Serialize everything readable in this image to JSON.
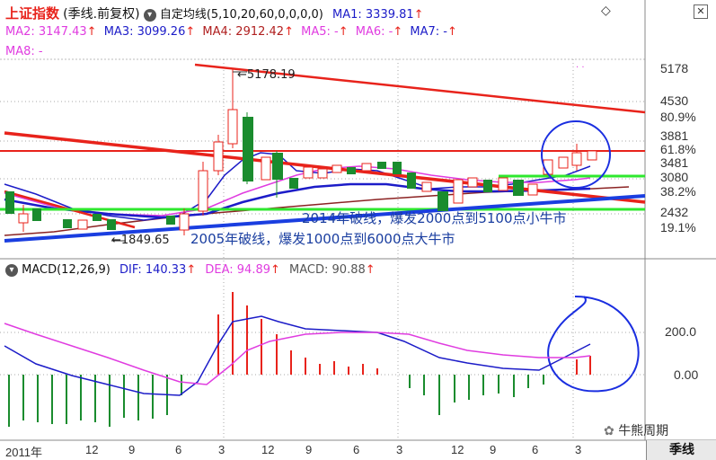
{
  "header": {
    "index_name": "上证指数",
    "period_label": "(季线.前复权)",
    "ma_selector": "自定均线(5,10,20,60,0,0,0,0)",
    "ma_values": [
      {
        "label": "MA1: 3339.81",
        "color": "#1c1cc8"
      },
      {
        "label": "MA2: 3147.43",
        "color": "#e03ce0"
      },
      {
        "label": "MA3: 3099.26",
        "color": "#1c1cc8"
      },
      {
        "label": "MA4: 2912.42",
        "color": "#b02020"
      },
      {
        "label": "MA5: -",
        "color": "#e03ce0"
      },
      {
        "label": "MA6: -",
        "color": "#e03ce0"
      },
      {
        "label": "MA7: -",
        "color": "#1c1cc8"
      },
      {
        "label": "MA8: -",
        "color": "#e03ce0"
      }
    ]
  },
  "price_axis": {
    "labels": [
      "5178",
      "4530",
      "80.9%",
      "3881",
      "61.8%",
      "3481",
      "3080",
      "38.2%",
      "2432",
      "19.1%"
    ]
  },
  "annotations": {
    "high_label": "5178.19",
    "low_label": "1849.65",
    "text_2014": "2014年破线，爆发2000点到5100点小牛市",
    "text_2005": "2005年破线，爆发1000点到6000点大牛市"
  },
  "macd": {
    "title": "MACD(12,26,9)",
    "dif": "DIF: 140.33",
    "dea": "DEA: 94.89",
    "macd": "MACD: 90.88",
    "axis": [
      "200.0",
      "0.00"
    ]
  },
  "x_axis": {
    "labels": [
      "2011年",
      "12",
      "9",
      "6",
      "3",
      "12",
      "9",
      "6",
      "3",
      "12",
      "9",
      "6",
      "3"
    ]
  },
  "period_button": "季线",
  "watermark": "牛熊周期",
  "colors": {
    "up": "#e8231b",
    "down": "#1a8c2e",
    "dif": "#1c1cc8",
    "dea": "#e03ce0"
  }
}
